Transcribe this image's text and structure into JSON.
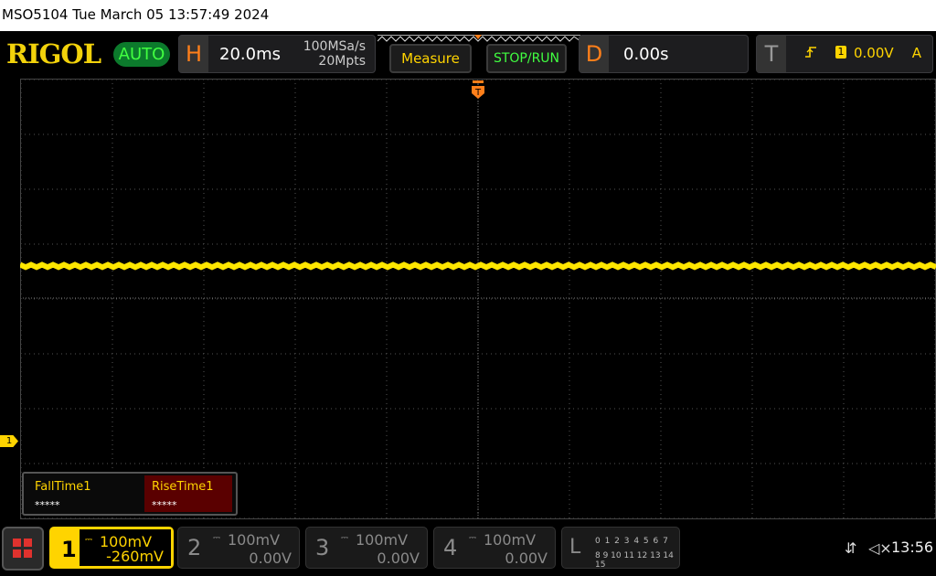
{
  "title_bar": "MSO5104  Tue March 05 13:57:49 2024",
  "logo": "RIGOL",
  "auto_label": "AUTO",
  "horizontal": {
    "letter": "H",
    "timebase": "20.0ms",
    "sample_rate": "100MSa/s",
    "memory_depth": "20Mpts"
  },
  "measure_label": "Measure",
  "stoprun_label": "STOP/RUN",
  "delay": {
    "letter": "D",
    "value": "0.00s"
  },
  "trigger": {
    "letter": "T",
    "channel": "1",
    "level": "0.00V",
    "mode": "A"
  },
  "ch1_marker": "1",
  "measurements": [
    {
      "label": "FallTime1",
      "value": "*****"
    },
    {
      "label": "RiseTime1",
      "value": "*****"
    }
  ],
  "channels": [
    {
      "number": "1",
      "scale": "100mV",
      "offset": "-260mV",
      "active": true
    },
    {
      "number": "2",
      "scale": "100mV",
      "offset": "0.00V",
      "active": false
    },
    {
      "number": "3",
      "scale": "100mV",
      "offset": "0.00V",
      "active": false
    },
    {
      "number": "4",
      "scale": "100mV",
      "offset": "0.00V",
      "active": false
    }
  ],
  "logic": {
    "letter": "L",
    "row1": "0 1 2 3   4 5 6 7",
    "row2": "8 9 10 11 12 13 14 15"
  },
  "clock": "13:56",
  "waveform": {
    "level_fraction_from_top": 0.425,
    "color": "#ffe600"
  },
  "colors": {
    "ch1": "#ffd400",
    "accent": "#ff7f1a",
    "green": "#41ff41"
  },
  "icons": [
    "usb-icon",
    "speaker-muted-icon",
    "home-icon"
  ]
}
